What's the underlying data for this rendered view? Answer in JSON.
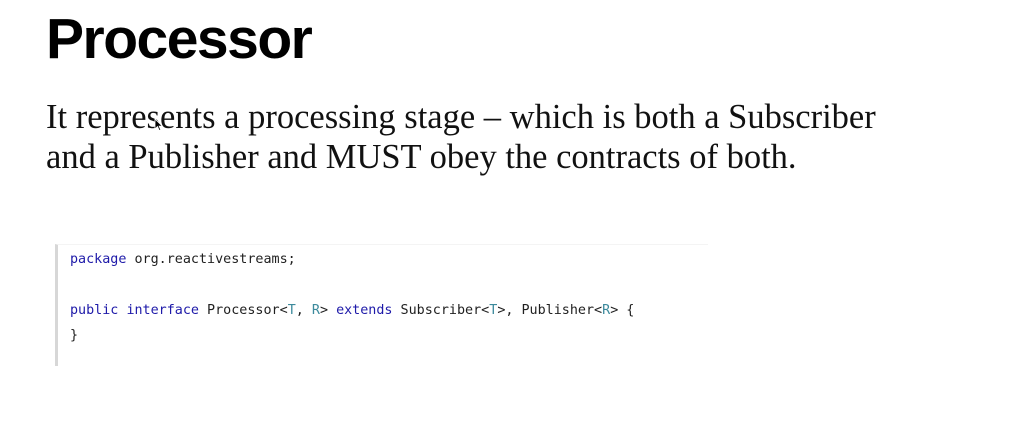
{
  "slide": {
    "title": "Processor",
    "body_lines": [
      "It represents a processing stage – which is both a Subscriber",
      "and a Publisher and MUST obey the contracts of both."
    ]
  },
  "code": {
    "line1": {
      "keyword": "package",
      "rest": " org.reactivestreams;"
    },
    "line2": {
      "kw_public": "public",
      "sp1": " ",
      "kw_interface": "interface",
      "name": " Processor<",
      "t1": "T",
      "comma1": ", ",
      "r1": "R",
      "close1": "> ",
      "kw_extends": "extends",
      "sub": " Subscriber<",
      "t2": "T",
      "pub": ">, Publisher<",
      "r2": "R",
      "open_brace": "> {"
    },
    "line3": {
      "close_brace": "}"
    }
  },
  "colors": {
    "keyword": "#1e1aa9",
    "type_param": "#3c8a9c",
    "text": "#1f1f1f",
    "gutter": "#d7d7d7"
  }
}
